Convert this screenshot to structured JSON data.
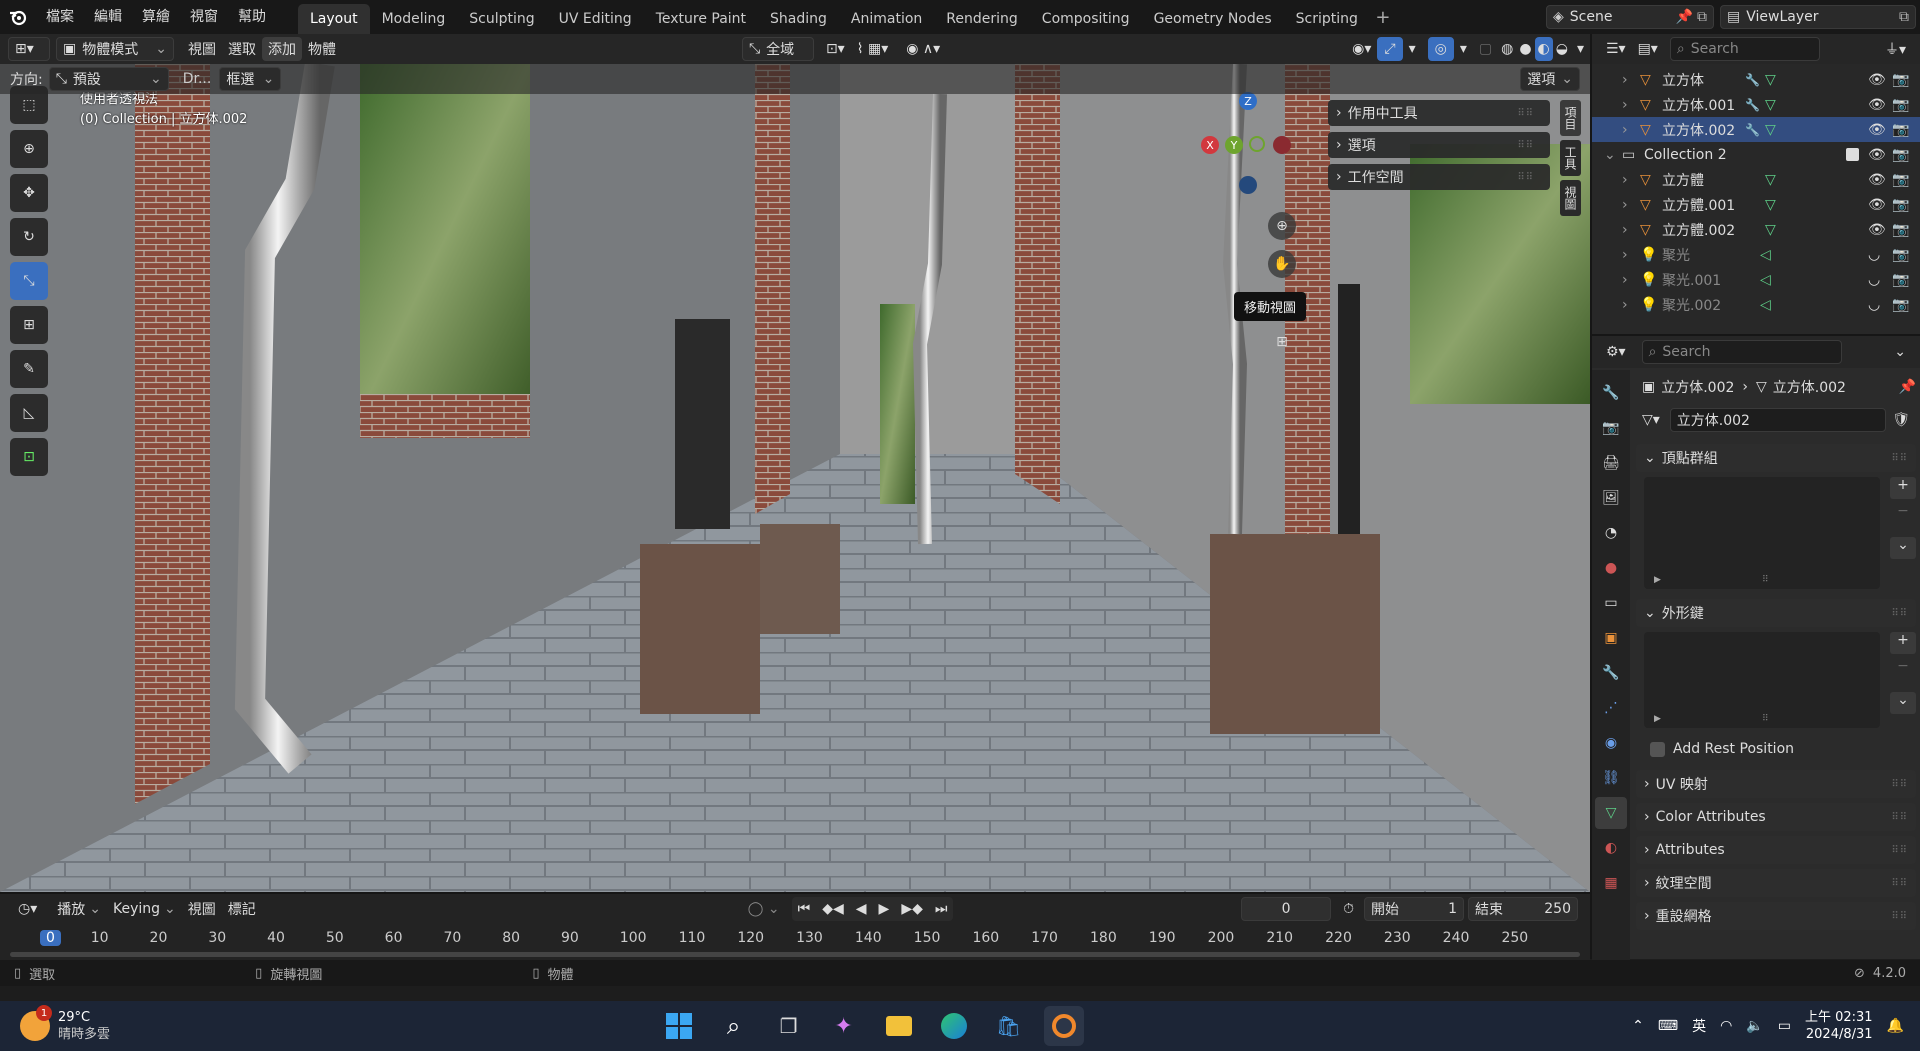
{
  "topbar": {
    "menus": [
      "檔案",
      "編輯",
      "算繪",
      "視窗",
      "幫助"
    ],
    "workspaces": [
      "Layout",
      "Modeling",
      "Sculpting",
      "UV Editing",
      "Texture Paint",
      "Shading",
      "Animation",
      "Rendering",
      "Compositing",
      "Geometry Nodes",
      "Scripting"
    ],
    "active_workspace": "Layout",
    "scene": "Scene",
    "view_layer": "ViewLayer"
  },
  "viewport": {
    "mode": "物體模式",
    "menus": [
      "視圖",
      "選取",
      "添加",
      "物體"
    ],
    "orientation_label": "方向:",
    "orientation_value": "預設",
    "drag_label": "Dr...",
    "drag_value": "框選",
    "transform_orientation": "全域",
    "options_label": "選項",
    "overlay_title": "使用者透視法",
    "overlay_subtitle": "(0) Collection | 立方体.002",
    "npanel": [
      "作用中工具",
      "選項",
      "工作空間"
    ],
    "side_tabs": [
      "項目",
      "工具",
      "視圖"
    ],
    "tooltip": "移動視圖",
    "gizmo": {
      "x": "X",
      "y": "Y",
      "z": "Z"
    }
  },
  "outliner": {
    "search_placeholder": "Search",
    "rows": [
      {
        "label": "立方体",
        "indent": 1,
        "type": "mesh",
        "sel": false,
        "dim": false
      },
      {
        "label": "立方体.001",
        "indent": 1,
        "type": "mesh",
        "sel": false,
        "dim": false
      },
      {
        "label": "立方体.002",
        "indent": 1,
        "type": "mesh",
        "sel": true,
        "dim": false
      },
      {
        "label": "Collection 2",
        "indent": 0,
        "type": "collection",
        "sel": false,
        "dim": false
      },
      {
        "label": "立方體",
        "indent": 1,
        "type": "mesh",
        "sel": false,
        "dim": false
      },
      {
        "label": "立方體.001",
        "indent": 1,
        "type": "mesh",
        "sel": false,
        "dim": false
      },
      {
        "label": "立方體.002",
        "indent": 1,
        "type": "mesh",
        "sel": false,
        "dim": false
      },
      {
        "label": "聚光",
        "indent": 1,
        "type": "light",
        "sel": false,
        "dim": true
      },
      {
        "label": "聚光.001",
        "indent": 1,
        "type": "light",
        "sel": false,
        "dim": true
      },
      {
        "label": "聚光.002",
        "indent": 1,
        "type": "light",
        "sel": false,
        "dim": true
      }
    ]
  },
  "properties": {
    "search_placeholder": "Search",
    "breadcrumb_object": "立方体.002",
    "breadcrumb_data": "立方体.002",
    "mesh_name": "立方体.002",
    "panel_vertex_groups": "頂點群組",
    "panel_shape_keys": "外形鍵",
    "add_rest_position": "Add Rest Position",
    "collapsed_panels": [
      "UV 映射",
      "Color Attributes",
      "Attributes",
      "紋理空間",
      "重設網格"
    ]
  },
  "timeline": {
    "menus": [
      "播放",
      "Keying",
      "視圖",
      "標記"
    ],
    "current_frame": "0",
    "start_label": "開始",
    "start_value": "1",
    "end_label": "結束",
    "end_value": "250",
    "ruler": [
      "0",
      "10",
      "20",
      "30",
      "40",
      "50",
      "60",
      "70",
      "80",
      "90",
      "100",
      "110",
      "120",
      "130",
      "140",
      "150",
      "160",
      "170",
      "180",
      "190",
      "200",
      "210",
      "220",
      "230",
      "240",
      "250"
    ]
  },
  "statusbar": {
    "select": "選取",
    "rotate": "旋轉視圖",
    "object": "物體",
    "version": "4.2.0"
  },
  "taskbar": {
    "weather_temp": "29°C",
    "weather_desc": "晴時多雲",
    "weather_badge": "1",
    "ime": "英",
    "time": "上午 02:31",
    "date": "2024/8/31"
  },
  "colors": {
    "accent": "#3a6fbf",
    "mesh_orange": "#e8913a",
    "data_green": "#5ecf88",
    "modifier_blue": "#6a9ee8"
  }
}
